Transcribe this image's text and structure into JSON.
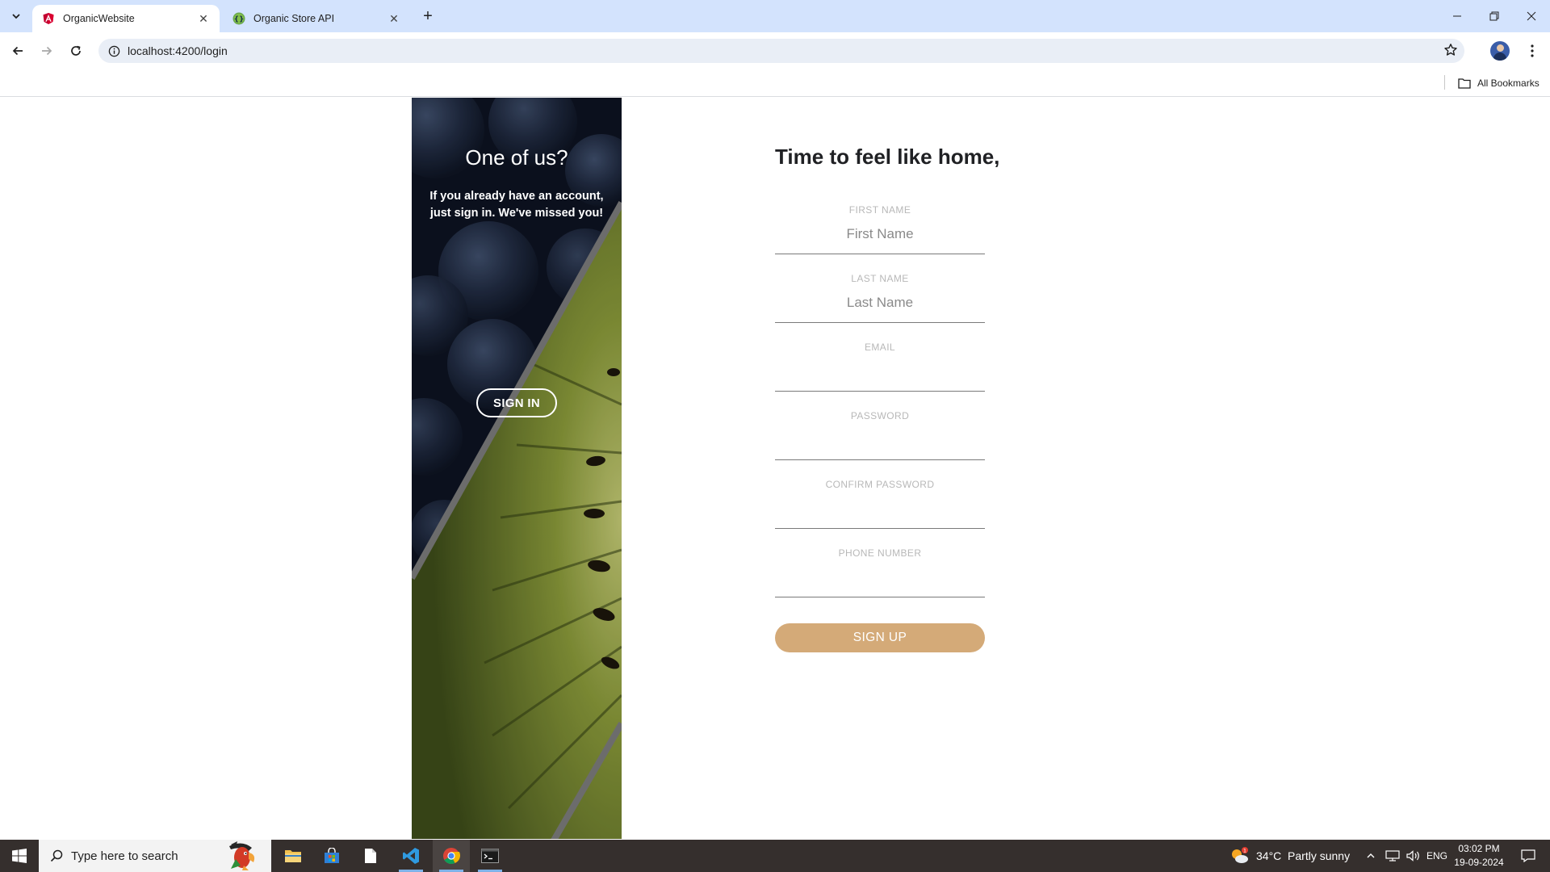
{
  "browser": {
    "tabs": [
      {
        "title": "OrganicWebsite",
        "active": true
      },
      {
        "title": "Organic Store API",
        "active": false
      }
    ],
    "url": "localhost:4200/login",
    "bookmarks_label": "All Bookmarks"
  },
  "side_panel": {
    "heading": "One of us?",
    "text": "If you already have an account, just sign in. We've missed you!",
    "signin_label": "SIGN IN"
  },
  "form": {
    "title": "Time to feel like home,",
    "fields": [
      {
        "label": "FIRST NAME",
        "placeholder": "First Name",
        "value": ""
      },
      {
        "label": "LAST NAME",
        "placeholder": "Last Name",
        "value": ""
      },
      {
        "label": "EMAIL",
        "placeholder": "",
        "value": ""
      },
      {
        "label": "PASSWORD",
        "placeholder": "",
        "value": ""
      },
      {
        "label": "CONFIRM PASSWORD",
        "placeholder": "",
        "value": ""
      },
      {
        "label": "PHONE NUMBER",
        "placeholder": "",
        "value": ""
      }
    ],
    "signup_label": "SIGN UP"
  },
  "taskbar": {
    "search_placeholder": "Type here to search",
    "weather": "34°C  Partly sunny",
    "weather_badge": "1",
    "language": "ENG",
    "time": "03:02 PM",
    "date": "19-09-2024"
  },
  "colors": {
    "tabstrip": "#d3e3fd",
    "signup_button": "#d4aa78",
    "taskbar": "#352f2d"
  }
}
